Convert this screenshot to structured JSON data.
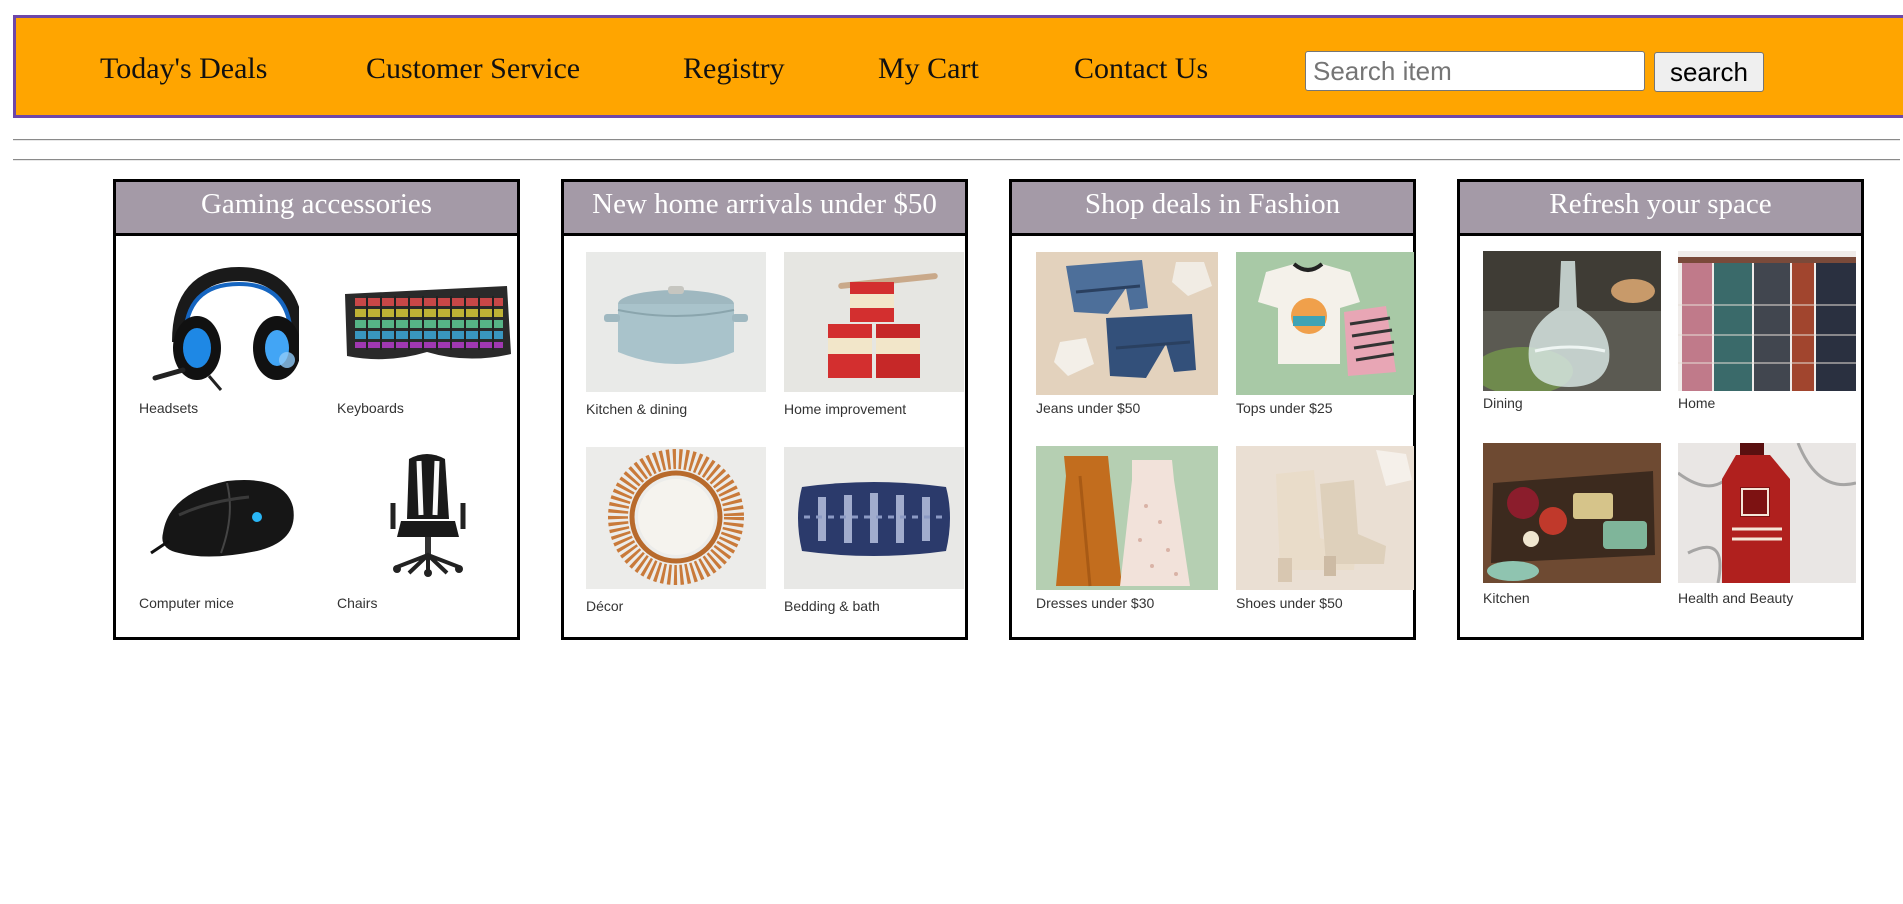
{
  "nav": {
    "items": [
      "Today's Deals",
      "Customer Service",
      "Registry",
      "My Cart",
      "Contact Us"
    ],
    "search_placeholder": "Search item",
    "search_button": "search",
    "background_color": "#ffa500",
    "border_color": "#6e47a8"
  },
  "cards": [
    {
      "title": "Gaming accessories",
      "tiles": [
        {
          "label": "Headsets",
          "icon": "headset-icon"
        },
        {
          "label": "Keyboards",
          "icon": "keyboard-icon"
        },
        {
          "label": "Computer mice",
          "icon": "mouse-icon"
        },
        {
          "label": "Chairs",
          "icon": "gaming-chair-icon"
        }
      ]
    },
    {
      "title": "New home arrivals under $50",
      "tiles": [
        {
          "label": "Kitchen & dining",
          "icon": "dutch-oven-icon"
        },
        {
          "label": "Home improvement",
          "icon": "paint-cans-icon"
        },
        {
          "label": "Décor",
          "icon": "sunburst-mirror-icon"
        },
        {
          "label": "Bedding & bath",
          "icon": "pillow-icon"
        }
      ]
    },
    {
      "title": "Shop deals in Fashion",
      "tiles": [
        {
          "label": "Jeans under $50",
          "icon": "jeans-icon"
        },
        {
          "label": "Tops under $25",
          "icon": "tops-icon"
        },
        {
          "label": "Dresses under $30",
          "icon": "dresses-icon"
        },
        {
          "label": "Shoes under $50",
          "icon": "boots-icon"
        }
      ]
    },
    {
      "title": "Refresh your space",
      "tiles": [
        {
          "label": "Dining",
          "icon": "glass-carafe-icon"
        },
        {
          "label": "Home",
          "icon": "towels-icon"
        },
        {
          "label": "Kitchen",
          "icon": "charcuterie-board-icon"
        },
        {
          "label": "Health and Beauty",
          "icon": "body-wash-bottle-icon"
        }
      ]
    }
  ],
  "colors": {
    "card_header": "#a49aa7",
    "card_border": "#000000"
  }
}
